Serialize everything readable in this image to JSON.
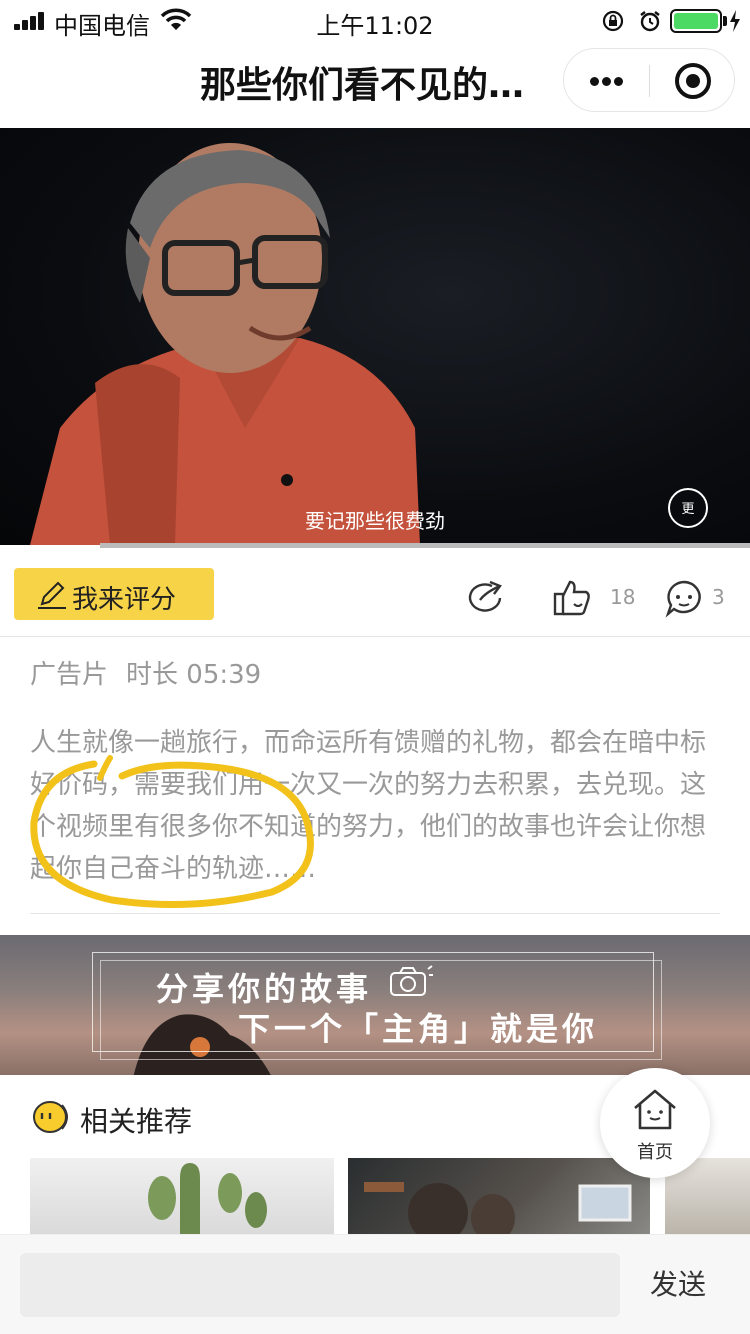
{
  "status_bar": {
    "carrier": "中国电信",
    "time": "上午11:02",
    "battery_level": 1.0,
    "battery_color": "#4cd964"
  },
  "nav": {
    "title": "那些你们看不见的…"
  },
  "video": {
    "subtitle": "要记那些很费劲",
    "watermark": "更广州"
  },
  "actions": {
    "rate_label": "我来评分",
    "like_count": "18",
    "comment_count": "3",
    "accent": "#f7d347"
  },
  "meta": {
    "category": "广告片",
    "duration": "时长 05:39"
  },
  "description": "人生就像一趟旅行，而命运所有馈赠的礼物，都会在暗中标好价码，需要我们用一次又一次的努力去积累，去兑现。这个视频里有很多你不知道的努力，他们的故事也许会让你想起你自己奋斗的轨迹……",
  "banner": {
    "line1": "分享你的故事",
    "line2": "下一个「主角」就是你"
  },
  "related": {
    "title": "相关推荐"
  },
  "home": {
    "label": "首页"
  },
  "bottom": {
    "input_value": "",
    "send_label": "发送"
  }
}
